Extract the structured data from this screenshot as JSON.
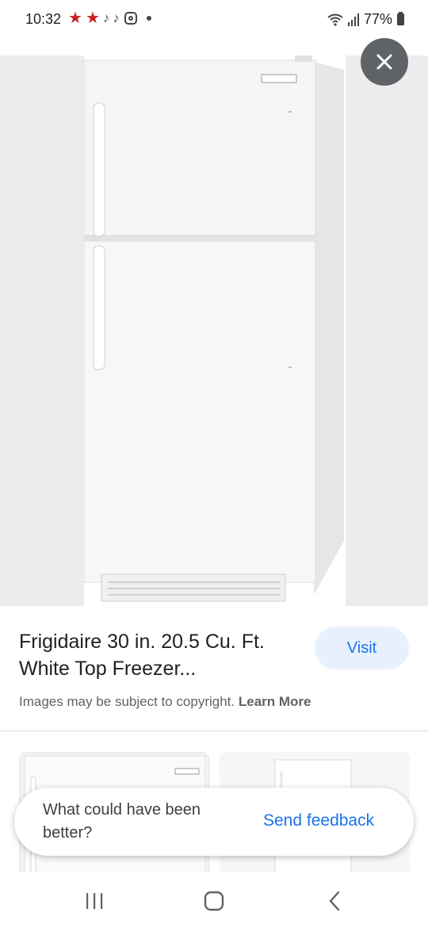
{
  "status_bar": {
    "time": "10:32",
    "battery": "77%"
  },
  "product": {
    "title": "Frigidaire 30 in. 20.5 Cu. Ft. White Top Freezer..."
  },
  "visit": {
    "label": "Visit"
  },
  "copyright": {
    "text": "Images may be subject to copyright.",
    "link": "Learn More"
  },
  "feedback": {
    "question": "What could have been better?",
    "action": "Send feedback"
  },
  "colors": {
    "accent": "#1a73e8",
    "visit_bg": "#e8f0fe",
    "close_bg": "#5f6368",
    "viewer_bg": "#ececec"
  },
  "icons": {
    "close": "close-icon",
    "recents": "recents-icon",
    "home": "home-icon",
    "back": "back-icon"
  }
}
